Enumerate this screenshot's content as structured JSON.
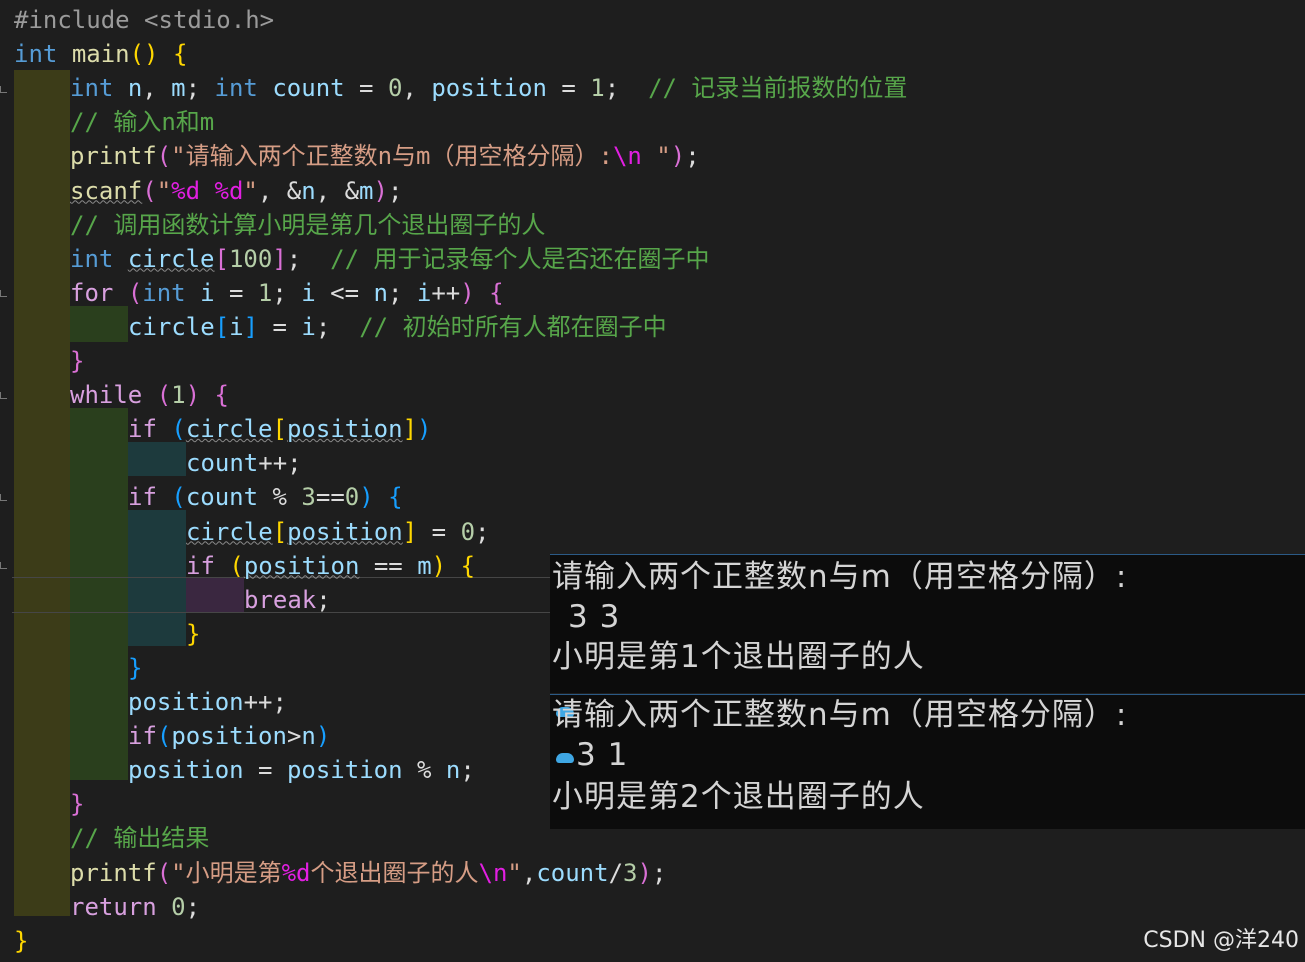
{
  "editor": {
    "lines": [
      {
        "seg": [
          {
            "t": "#include <stdio.h>",
            "c": "pp"
          }
        ]
      },
      {
        "seg": [
          {
            "t": "int",
            "c": "kw"
          },
          {
            "t": " "
          },
          {
            "t": "main",
            "c": "fn"
          },
          {
            "t": "()",
            "c": "p1"
          },
          {
            "t": " "
          },
          {
            "t": "{",
            "c": "p1"
          }
        ]
      },
      {
        "seg": [
          {
            "t": "int",
            "c": "kw"
          },
          {
            "t": " "
          },
          {
            "t": "n",
            "c": "var"
          },
          {
            "t": ", "
          },
          {
            "t": "m",
            "c": "var"
          },
          {
            "t": "; "
          },
          {
            "t": "int",
            "c": "kw"
          },
          {
            "t": " "
          },
          {
            "t": "count",
            "c": "var"
          },
          {
            "t": " = "
          },
          {
            "t": "0",
            "c": "num"
          },
          {
            "t": ", "
          },
          {
            "t": "position",
            "c": "var"
          },
          {
            "t": " = "
          },
          {
            "t": "1",
            "c": "num"
          },
          {
            "t": ";  "
          },
          {
            "t": "// 记录当前报数的位置",
            "c": "cmt"
          }
        ]
      },
      {
        "seg": [
          {
            "t": "// 输入n和m",
            "c": "cmt"
          }
        ]
      },
      {
        "seg": [
          {
            "t": "printf",
            "c": "fn"
          },
          {
            "t": "(",
            "c": "p2"
          },
          {
            "t": "\"请输入两个正整数n与m（用空格分隔）:",
            "c": "str"
          },
          {
            "t": "\\n",
            "c": "esc"
          },
          {
            "t": " \"",
            "c": "str"
          },
          {
            "t": ")",
            "c": "p2"
          },
          {
            "t": ";"
          }
        ]
      },
      {
        "seg": [
          {
            "t": "scanf",
            "c": "fn",
            "u": 1
          },
          {
            "t": "(",
            "c": "p2"
          },
          {
            "t": "\"",
            "c": "str"
          },
          {
            "t": "%d %d",
            "c": "esc"
          },
          {
            "t": "\"",
            "c": "str"
          },
          {
            "t": ", &"
          },
          {
            "t": "n",
            "c": "var"
          },
          {
            "t": ", &"
          },
          {
            "t": "m",
            "c": "var"
          },
          {
            "t": ")",
            "c": "p2"
          },
          {
            "t": ";"
          }
        ]
      },
      {
        "seg": [
          {
            "t": "// 调用函数计算小明是第几个退出圈子的人",
            "c": "cmt"
          }
        ]
      },
      {
        "seg": [
          {
            "t": "int",
            "c": "kw"
          },
          {
            "t": " "
          },
          {
            "t": "circle",
            "c": "var",
            "u": 1
          },
          {
            "t": "[",
            "c": "p2"
          },
          {
            "t": "100",
            "c": "num"
          },
          {
            "t": "]",
            "c": "p2"
          },
          {
            "t": ";  "
          },
          {
            "t": "// 用于记录每个人是否还在圈子中",
            "c": "cmt"
          }
        ]
      },
      {
        "seg": [
          {
            "t": "for",
            "c": "ctl"
          },
          {
            "t": " "
          },
          {
            "t": "(",
            "c": "p2"
          },
          {
            "t": "int",
            "c": "kw"
          },
          {
            "t": " "
          },
          {
            "t": "i",
            "c": "var"
          },
          {
            "t": " = "
          },
          {
            "t": "1",
            "c": "num"
          },
          {
            "t": "; "
          },
          {
            "t": "i",
            "c": "var"
          },
          {
            "t": " <= "
          },
          {
            "t": "n",
            "c": "var"
          },
          {
            "t": "; "
          },
          {
            "t": "i",
            "c": "var"
          },
          {
            "t": "++"
          },
          {
            "t": ")",
            "c": "p2"
          },
          {
            "t": " "
          },
          {
            "t": "{",
            "c": "p2"
          }
        ]
      },
      {
        "seg": [
          {
            "t": "circle",
            "c": "var"
          },
          {
            "t": "[",
            "c": "p3"
          },
          {
            "t": "i",
            "c": "var"
          },
          {
            "t": "]",
            "c": "p3"
          },
          {
            "t": " = "
          },
          {
            "t": "i",
            "c": "var"
          },
          {
            "t": ";  "
          },
          {
            "t": "// 初始时所有人都在圈子中",
            "c": "cmt"
          }
        ]
      },
      {
        "seg": [
          {
            "t": "}",
            "c": "p2"
          }
        ]
      },
      {
        "seg": [
          {
            "t": "while",
            "c": "ctl"
          },
          {
            "t": " "
          },
          {
            "t": "(",
            "c": "p2"
          },
          {
            "t": "1",
            "c": "num"
          },
          {
            "t": ")",
            "c": "p2"
          },
          {
            "t": " "
          },
          {
            "t": "{",
            "c": "p2"
          }
        ]
      },
      {
        "seg": [
          {
            "t": "if",
            "c": "ctl"
          },
          {
            "t": " "
          },
          {
            "t": "(",
            "c": "p3"
          },
          {
            "t": "circle",
            "c": "var",
            "u": 1
          },
          {
            "t": "[",
            "c": "p1"
          },
          {
            "t": "position",
            "c": "var",
            "u": 1
          },
          {
            "t": "]",
            "c": "p1"
          },
          {
            "t": ")",
            "c": "p3"
          }
        ]
      },
      {
        "seg": [
          {
            "t": "count",
            "c": "var"
          },
          {
            "t": "++;"
          }
        ]
      },
      {
        "seg": [
          {
            "t": "if",
            "c": "ctl"
          },
          {
            "t": " "
          },
          {
            "t": "(",
            "c": "p3"
          },
          {
            "t": "count",
            "c": "var"
          },
          {
            "t": " % "
          },
          {
            "t": "3",
            "c": "num"
          },
          {
            "t": "=="
          },
          {
            "t": "0",
            "c": "num"
          },
          {
            "t": ")",
            "c": "p3"
          },
          {
            "t": " "
          },
          {
            "t": "{",
            "c": "p3"
          }
        ]
      },
      {
        "seg": [
          {
            "t": "circle",
            "c": "var",
            "u": 1
          },
          {
            "t": "[",
            "c": "p1"
          },
          {
            "t": "position",
            "c": "var",
            "u": 1
          },
          {
            "t": "]",
            "c": "p1"
          },
          {
            "t": " = "
          },
          {
            "t": "0",
            "c": "num"
          },
          {
            "t": ";"
          }
        ]
      },
      {
        "seg": [
          {
            "t": "if",
            "c": "ctl"
          },
          {
            "t": " "
          },
          {
            "t": "(",
            "c": "p1"
          },
          {
            "t": "position",
            "c": "var",
            "u": 1
          },
          {
            "t": " == "
          },
          {
            "t": "m",
            "c": "var"
          },
          {
            "t": ")",
            "c": "p1"
          },
          {
            "t": " "
          },
          {
            "t": "{",
            "c": "p1"
          }
        ]
      },
      {
        "seg": [
          {
            "t": "break",
            "c": "ctl"
          },
          {
            "t": ";"
          }
        ]
      },
      {
        "seg": [
          {
            "t": "}",
            "c": "p1"
          }
        ]
      },
      {
        "seg": [
          {
            "t": "}",
            "c": "p3"
          }
        ]
      },
      {
        "seg": [
          {
            "t": "position",
            "c": "var"
          },
          {
            "t": "++;"
          }
        ]
      },
      {
        "seg": [
          {
            "t": "if",
            "c": "ctl"
          },
          {
            "t": "(",
            "c": "p3"
          },
          {
            "t": "position",
            "c": "var"
          },
          {
            "t": ">"
          },
          {
            "t": "n",
            "c": "var"
          },
          {
            "t": ")",
            "c": "p3"
          }
        ]
      },
      {
        "seg": [
          {
            "t": "position",
            "c": "var"
          },
          {
            "t": " = "
          },
          {
            "t": "position",
            "c": "var"
          },
          {
            "t": " % "
          },
          {
            "t": "n",
            "c": "var"
          },
          {
            "t": ";"
          }
        ]
      },
      {
        "seg": [
          {
            "t": "}",
            "c": "p2"
          }
        ]
      },
      {
        "seg": [
          {
            "t": "// 输出结果",
            "c": "cmt"
          }
        ]
      },
      {
        "seg": [
          {
            "t": "printf",
            "c": "fn"
          },
          {
            "t": "(",
            "c": "p2"
          },
          {
            "t": "\"小明是第",
            "c": "str"
          },
          {
            "t": "%d",
            "c": "esc"
          },
          {
            "t": "个退出圈子的人",
            "c": "str"
          },
          {
            "t": "\\n",
            "c": "esc"
          },
          {
            "t": "\"",
            "c": "str"
          },
          {
            "t": ","
          },
          {
            "t": "count",
            "c": "var"
          },
          {
            "t": "/"
          },
          {
            "t": "3",
            "c": "num"
          },
          {
            "t": ")",
            "c": "p2"
          },
          {
            "t": ";"
          }
        ]
      },
      {
        "seg": [
          {
            "t": "return",
            "c": "ctl"
          },
          {
            "t": " "
          },
          {
            "t": "0",
            "c": "num"
          },
          {
            "t": ";"
          }
        ]
      },
      {
        "seg": [
          {
            "t": "}",
            "c": "p1"
          }
        ]
      }
    ]
  },
  "console_1": {
    "prompt": "请输入两个正整数n与m（用空格分隔）:",
    "input": "3 3",
    "result": "小明是第1个退出圈子的人"
  },
  "console_2": {
    "prompt": "请输入两个正整数n与m（用空格分隔）:",
    "input": "3 1",
    "result": "小明是第2个退出圈子的人"
  },
  "watermark": "CSDN @洋240",
  "colors": {
    "background": "#1e1e1e",
    "keyword": "#569cd6",
    "control": "#d8a0df",
    "function": "#dcdcaa",
    "variable": "#9cdcfe",
    "number": "#b5cea8",
    "string": "#d69d85",
    "comment": "#57a64a",
    "console_bg": "#0c0c0c"
  }
}
